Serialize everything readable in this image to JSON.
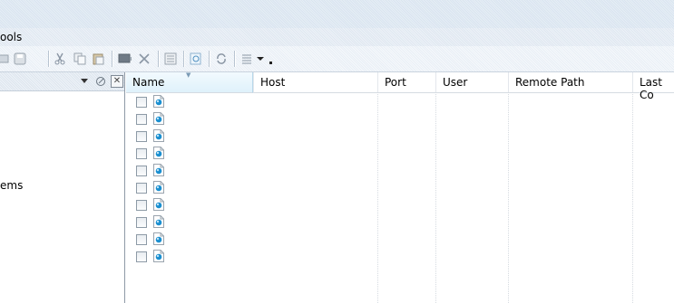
{
  "menu": {
    "tools_label": "ools"
  },
  "toolbar": {
    "buttons": [
      "new-session-icon",
      "save-icon",
      "cut-icon",
      "copy-icon",
      "paste-icon",
      "terminal-icon",
      "delete-icon",
      "properties-icon",
      "preview-icon",
      "refresh-icon",
      "view-icon",
      "dropdown-arrow-icon"
    ]
  },
  "left_pane": {
    "dropdown_icon": "chevron-down-icon",
    "pin_icon": "pin-icon",
    "close_icon": "close-icon",
    "close_glyph": "✕",
    "items_text": "ems"
  },
  "list": {
    "columns": [
      "Name",
      "Host",
      "Port",
      "User",
      "Remote Path",
      "Last Co"
    ],
    "rows": [
      {
        "checked": false,
        "name": ""
      },
      {
        "checked": false,
        "name": ""
      },
      {
        "checked": false,
        "name": ""
      },
      {
        "checked": false,
        "name": ""
      },
      {
        "checked": false,
        "name": ""
      },
      {
        "checked": false,
        "name": ""
      },
      {
        "checked": false,
        "name": ""
      },
      {
        "checked": false,
        "name": ""
      },
      {
        "checked": false,
        "name": ""
      },
      {
        "checked": false,
        "name": ""
      }
    ]
  },
  "colors": {
    "accent": "#1a8fd0",
    "header_sorted": "#dff1fb",
    "border": "#8f9aa6"
  }
}
